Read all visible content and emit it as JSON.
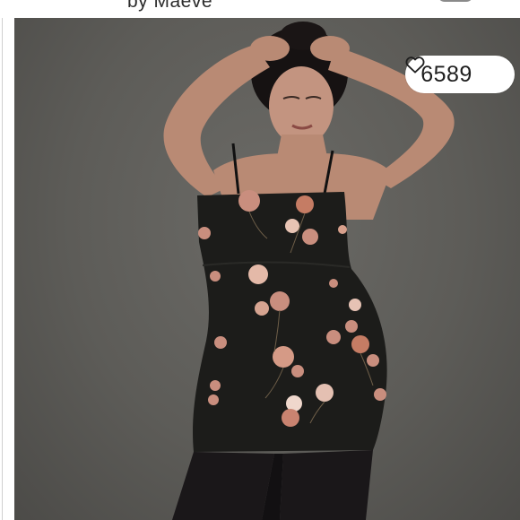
{
  "header": {
    "brand_text": "by Maeve"
  },
  "listing": {
    "like_count": "6589",
    "like_icon": "heart-outline-icon",
    "photo_subject": "listing-photo"
  },
  "colors": {
    "background": "#5d5c58",
    "dress": "#1c1c1a",
    "sequin_flower": "#c98e7e",
    "tights": "#1a1719"
  }
}
